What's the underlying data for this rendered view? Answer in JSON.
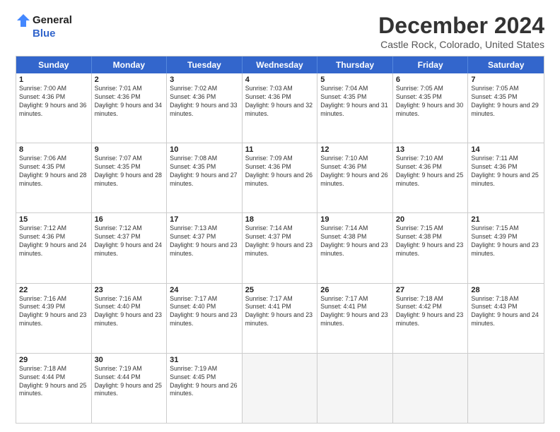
{
  "logo": {
    "line1": "General",
    "line2": "Blue"
  },
  "title": "December 2024",
  "subtitle": "Castle Rock, Colorado, United States",
  "header_days": [
    "Sunday",
    "Monday",
    "Tuesday",
    "Wednesday",
    "Thursday",
    "Friday",
    "Saturday"
  ],
  "weeks": [
    [
      {
        "day": "1",
        "sunrise": "Sunrise: 7:00 AM",
        "sunset": "Sunset: 4:36 PM",
        "daylight": "Daylight: 9 hours and 36 minutes."
      },
      {
        "day": "2",
        "sunrise": "Sunrise: 7:01 AM",
        "sunset": "Sunset: 4:36 PM",
        "daylight": "Daylight: 9 hours and 34 minutes."
      },
      {
        "day": "3",
        "sunrise": "Sunrise: 7:02 AM",
        "sunset": "Sunset: 4:36 PM",
        "daylight": "Daylight: 9 hours and 33 minutes."
      },
      {
        "day": "4",
        "sunrise": "Sunrise: 7:03 AM",
        "sunset": "Sunset: 4:36 PM",
        "daylight": "Daylight: 9 hours and 32 minutes."
      },
      {
        "day": "5",
        "sunrise": "Sunrise: 7:04 AM",
        "sunset": "Sunset: 4:35 PM",
        "daylight": "Daylight: 9 hours and 31 minutes."
      },
      {
        "day": "6",
        "sunrise": "Sunrise: 7:05 AM",
        "sunset": "Sunset: 4:35 PM",
        "daylight": "Daylight: 9 hours and 30 minutes."
      },
      {
        "day": "7",
        "sunrise": "Sunrise: 7:05 AM",
        "sunset": "Sunset: 4:35 PM",
        "daylight": "Daylight: 9 hours and 29 minutes."
      }
    ],
    [
      {
        "day": "8",
        "sunrise": "Sunrise: 7:06 AM",
        "sunset": "Sunset: 4:35 PM",
        "daylight": "Daylight: 9 hours and 28 minutes."
      },
      {
        "day": "9",
        "sunrise": "Sunrise: 7:07 AM",
        "sunset": "Sunset: 4:35 PM",
        "daylight": "Daylight: 9 hours and 28 minutes."
      },
      {
        "day": "10",
        "sunrise": "Sunrise: 7:08 AM",
        "sunset": "Sunset: 4:35 PM",
        "daylight": "Daylight: 9 hours and 27 minutes."
      },
      {
        "day": "11",
        "sunrise": "Sunrise: 7:09 AM",
        "sunset": "Sunset: 4:36 PM",
        "daylight": "Daylight: 9 hours and 26 minutes."
      },
      {
        "day": "12",
        "sunrise": "Sunrise: 7:10 AM",
        "sunset": "Sunset: 4:36 PM",
        "daylight": "Daylight: 9 hours and 26 minutes."
      },
      {
        "day": "13",
        "sunrise": "Sunrise: 7:10 AM",
        "sunset": "Sunset: 4:36 PM",
        "daylight": "Daylight: 9 hours and 25 minutes."
      },
      {
        "day": "14",
        "sunrise": "Sunrise: 7:11 AM",
        "sunset": "Sunset: 4:36 PM",
        "daylight": "Daylight: 9 hours and 25 minutes."
      }
    ],
    [
      {
        "day": "15",
        "sunrise": "Sunrise: 7:12 AM",
        "sunset": "Sunset: 4:36 PM",
        "daylight": "Daylight: 9 hours and 24 minutes."
      },
      {
        "day": "16",
        "sunrise": "Sunrise: 7:12 AM",
        "sunset": "Sunset: 4:37 PM",
        "daylight": "Daylight: 9 hours and 24 minutes."
      },
      {
        "day": "17",
        "sunrise": "Sunrise: 7:13 AM",
        "sunset": "Sunset: 4:37 PM",
        "daylight": "Daylight: 9 hours and 23 minutes."
      },
      {
        "day": "18",
        "sunrise": "Sunrise: 7:14 AM",
        "sunset": "Sunset: 4:37 PM",
        "daylight": "Daylight: 9 hours and 23 minutes."
      },
      {
        "day": "19",
        "sunrise": "Sunrise: 7:14 AM",
        "sunset": "Sunset: 4:38 PM",
        "daylight": "Daylight: 9 hours and 23 minutes."
      },
      {
        "day": "20",
        "sunrise": "Sunrise: 7:15 AM",
        "sunset": "Sunset: 4:38 PM",
        "daylight": "Daylight: 9 hours and 23 minutes."
      },
      {
        "day": "21",
        "sunrise": "Sunrise: 7:15 AM",
        "sunset": "Sunset: 4:39 PM",
        "daylight": "Daylight: 9 hours and 23 minutes."
      }
    ],
    [
      {
        "day": "22",
        "sunrise": "Sunrise: 7:16 AM",
        "sunset": "Sunset: 4:39 PM",
        "daylight": "Daylight: 9 hours and 23 minutes."
      },
      {
        "day": "23",
        "sunrise": "Sunrise: 7:16 AM",
        "sunset": "Sunset: 4:40 PM",
        "daylight": "Daylight: 9 hours and 23 minutes."
      },
      {
        "day": "24",
        "sunrise": "Sunrise: 7:17 AM",
        "sunset": "Sunset: 4:40 PM",
        "daylight": "Daylight: 9 hours and 23 minutes."
      },
      {
        "day": "25",
        "sunrise": "Sunrise: 7:17 AM",
        "sunset": "Sunset: 4:41 PM",
        "daylight": "Daylight: 9 hours and 23 minutes."
      },
      {
        "day": "26",
        "sunrise": "Sunrise: 7:17 AM",
        "sunset": "Sunset: 4:41 PM",
        "daylight": "Daylight: 9 hours and 23 minutes."
      },
      {
        "day": "27",
        "sunrise": "Sunrise: 7:18 AM",
        "sunset": "Sunset: 4:42 PM",
        "daylight": "Daylight: 9 hours and 23 minutes."
      },
      {
        "day": "28",
        "sunrise": "Sunrise: 7:18 AM",
        "sunset": "Sunset: 4:43 PM",
        "daylight": "Daylight: 9 hours and 24 minutes."
      }
    ],
    [
      {
        "day": "29",
        "sunrise": "Sunrise: 7:18 AM",
        "sunset": "Sunset: 4:44 PM",
        "daylight": "Daylight: 9 hours and 25 minutes."
      },
      {
        "day": "30",
        "sunrise": "Sunrise: 7:19 AM",
        "sunset": "Sunset: 4:44 PM",
        "daylight": "Daylight: 9 hours and 25 minutes."
      },
      {
        "day": "31",
        "sunrise": "Sunrise: 7:19 AM",
        "sunset": "Sunset: 4:45 PM",
        "daylight": "Daylight: 9 hours and 26 minutes."
      },
      {
        "day": "",
        "sunrise": "",
        "sunset": "",
        "daylight": ""
      },
      {
        "day": "",
        "sunrise": "",
        "sunset": "",
        "daylight": ""
      },
      {
        "day": "",
        "sunrise": "",
        "sunset": "",
        "daylight": ""
      },
      {
        "day": "",
        "sunrise": "",
        "sunset": "",
        "daylight": ""
      }
    ]
  ]
}
